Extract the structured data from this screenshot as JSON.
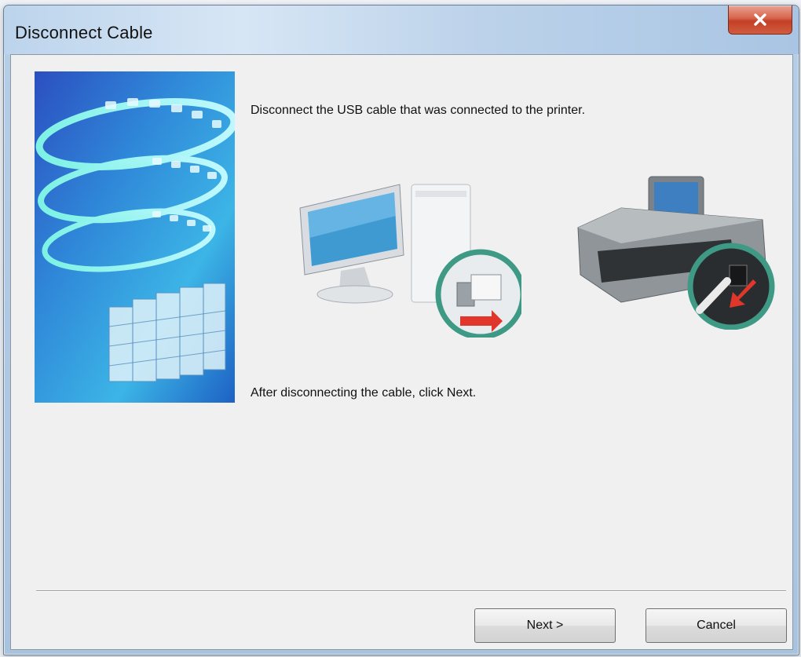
{
  "window": {
    "title": "Disconnect Cable"
  },
  "instructions": {
    "primary": "Disconnect the USB cable that was connected to the printer.",
    "secondary": "After disconnecting the cable, click Next."
  },
  "buttons": {
    "next_label": "Next >",
    "cancel_label": "Cancel"
  },
  "icons": {
    "close": "close-icon",
    "computer": "computer-illustration",
    "printer": "printer-illustration",
    "unplug": "unplug-arrow-icon"
  },
  "colors": {
    "close_button": "#d0533a",
    "dialog_bg": "#f0f0f0",
    "titlebar": "#bcd4ec",
    "ring": "#3e9a84",
    "arrow": "#e0372a"
  }
}
